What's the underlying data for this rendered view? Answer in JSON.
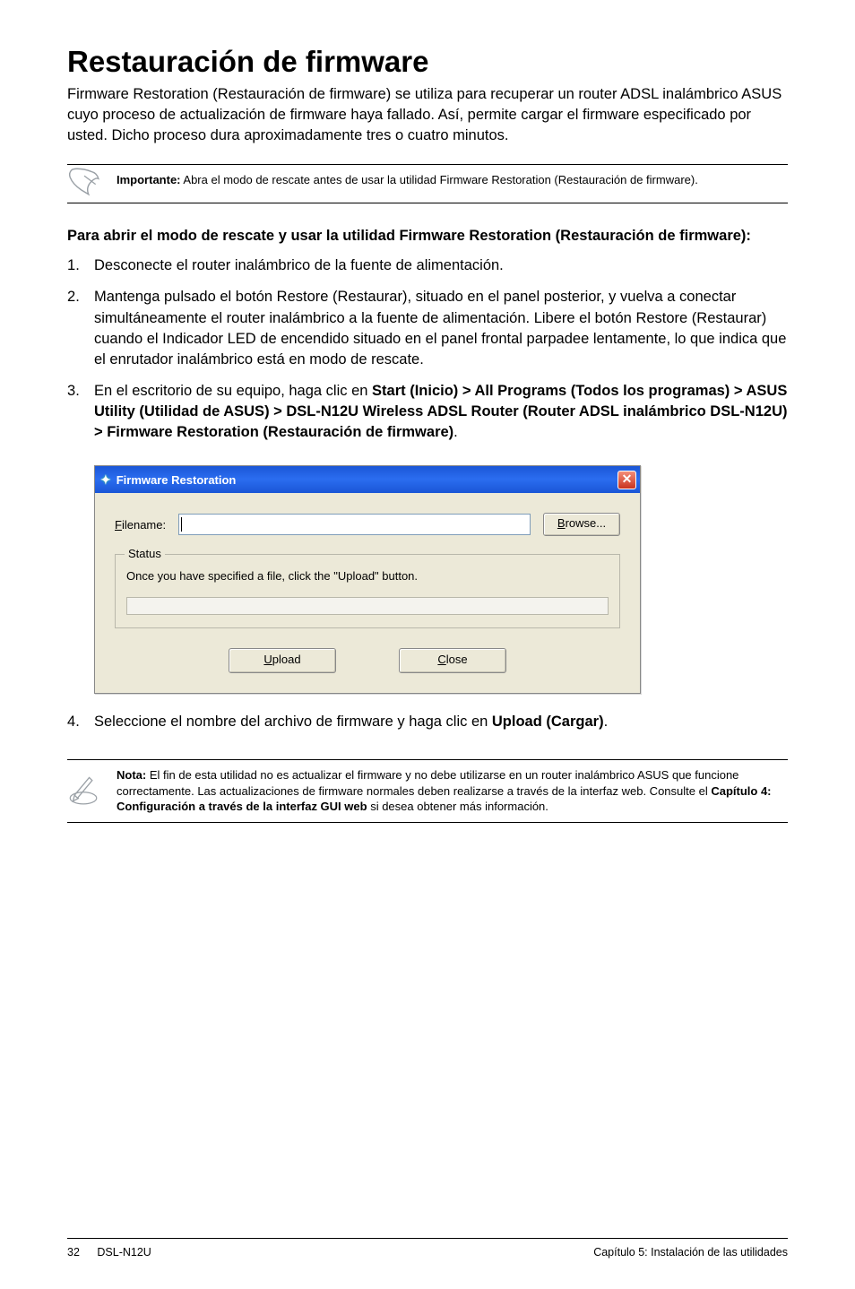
{
  "title": "Restauración de firmware",
  "intro": "Firmware Restoration (Restauración de firmware) se utiliza para recuperar un router ADSL inalámbrico ASUS cuyo proceso de actualización de firmware haya fallado. Así, permite cargar el firmware especificado por usted. Dicho proceso dura aproximadamente tres o cuatro minutos.",
  "important_box": {
    "bold": "Importante:",
    "text": " Abra el modo de rescate antes de usar la utilidad Firmware Restoration (Restauración de firmware)."
  },
  "section_heading": "Para abrir el modo de rescate y usar la utilidad Firmware Restoration (Restauración de firmware):",
  "steps": [
    "Desconecte el router inalámbrico de la fuente de alimentación.",
    "Mantenga pulsado el botón Restore (Restaurar), situado en el panel posterior, y vuelva a conectar simultáneamente el router inalámbrico a la fuente de alimentación. Libere el botón Restore (Restaurar) cuando el Indicador LED de encendido situado en el panel frontal parpadee lentamente, lo que indica que el enrutador inalámbrico está en modo de rescate."
  ],
  "step3": {
    "prefix": "En el escritorio de su equipo, haga clic en ",
    "bold": "Start (Inicio) > All Programs (Todos los programas) > ASUS Utility (Utilidad de ASUS) > DSL-N12U Wireless ADSL Router (Router ADSL inalámbrico DSL-N12U) > Firmware Restoration (Restauración de firmware)",
    "suffix": "."
  },
  "dialog": {
    "title": "Firmware Restoration",
    "filename_label_u": "F",
    "filename_label_rest": "ilename:",
    "browse_u": "B",
    "browse_rest": "rowse...",
    "status_legend": "Status",
    "status_text": "Once you have specified a file, click the \"Upload\" button.",
    "upload_u": "U",
    "upload_rest": "pload",
    "close_u": "C",
    "close_rest": "lose"
  },
  "step4": {
    "prefix": "Seleccione el nombre del archivo de firmware y haga clic en ",
    "bold": "Upload (Cargar)",
    "suffix": "."
  },
  "note_box": {
    "bold": "Nota:",
    "before_bold2": " El fin de esta utilidad no es actualizar el firmware y no debe utilizarse en un router inalámbrico ASUS que funcione correctamente. Las actualizaciones de firmware normales deben realizarse a través de la interfaz web. Consulte el ",
    "bold2": "Capítulo 4: Configuración a través de la interfaz GUI web",
    "after_bold2": " si desea obtener más información."
  },
  "footer": {
    "page": "32",
    "model": "DSL-N12U",
    "chapter": "Capítulo 5: Instalación de las utilidades"
  }
}
